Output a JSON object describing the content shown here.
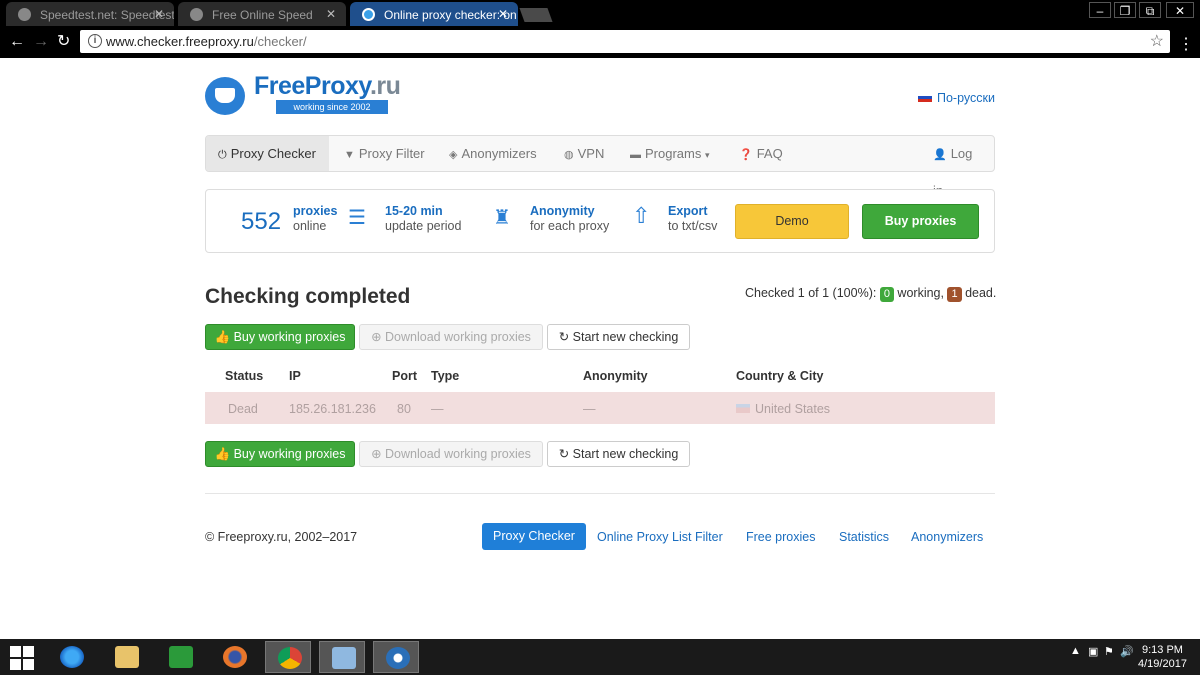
{
  "browser": {
    "tabs": [
      {
        "label": "Speedtest.net: Speedtest"
      },
      {
        "label": "Free Online Speed"
      },
      {
        "label": "Online proxy checker: on"
      }
    ],
    "url_domain": "www.checker.freeproxy.ru",
    "url_path": "/checker/"
  },
  "header": {
    "logo_main": "FreeProxy",
    "logo_tld": ".ru",
    "ribbon": "working since 2002",
    "lang_link": "По-русски"
  },
  "nav": {
    "items": [
      {
        "label": "Proxy Checker",
        "icon": "power-icon"
      },
      {
        "label": "Proxy Filter",
        "icon": "filter-icon"
      },
      {
        "label": "Anonymizers",
        "icon": "eye-icon"
      },
      {
        "label": "VPN",
        "icon": "globe-icon"
      },
      {
        "label": "Programs",
        "icon": "hdd-icon"
      },
      {
        "label": "FAQ",
        "icon": "question-icon"
      }
    ],
    "login": "Log in"
  },
  "stats": {
    "count": "552",
    "count_label": "proxies",
    "count_sub": "online",
    "period": "15-20 min",
    "period_sub": "update period",
    "anon": "Anonymity",
    "anon_sub": "for each proxy",
    "export": "Export",
    "export_sub": "to txt/csv",
    "demo_btn": "Demo",
    "buy_btn": "Buy proxies"
  },
  "result": {
    "title": "Checking completed",
    "summary_prefix": "Checked 1 of 1 (100%):",
    "working_count": "0",
    "working_label": "working,",
    "dead_count": "1",
    "dead_label": "dead."
  },
  "buttons": {
    "buy_working": "Buy working proxies",
    "download_working": "Download working proxies",
    "start_new": "Start new checking"
  },
  "table": {
    "headers": [
      "Status",
      "IP",
      "Port",
      "Type",
      "Anonymity",
      "Country & City"
    ],
    "rows": [
      {
        "status": "Dead",
        "ip": "185.26.181.236",
        "port": "80",
        "type": "—",
        "anonymity": "—",
        "country": "United States"
      }
    ]
  },
  "footer": {
    "copyright": "© Freeproxy.ru, 2002–2017",
    "links": [
      "Proxy Checker",
      "Online Proxy List Filter",
      "Free proxies",
      "Statistics",
      "Anonymizers"
    ]
  },
  "taskbar": {
    "time": "9:13 PM",
    "date": "4/19/2017"
  },
  "colors": {
    "brand_blue": "#1a6dbf",
    "green": "#3fa83b",
    "demo_yellow": "#f7c739",
    "dead_row": "#f2dede"
  }
}
